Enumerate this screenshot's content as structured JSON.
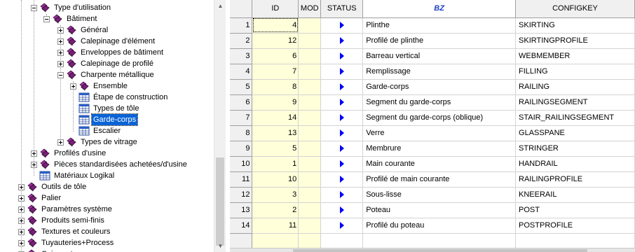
{
  "tree": {
    "nodes": [
      {
        "label": "Type d'utilisation",
        "icon": "books-icon",
        "expander": "minus"
      },
      {
        "label": "Bâtiment",
        "icon": "books-icon",
        "expander": "minus"
      },
      {
        "label": "Général",
        "icon": "books-icon",
        "expander": "plus"
      },
      {
        "label": "Calepinage d'élément",
        "icon": "books-icon",
        "expander": "plus"
      },
      {
        "label": "Enveloppes de bâtiment",
        "icon": "books-icon",
        "expander": "plus"
      },
      {
        "label": "Calepinage de profilé",
        "icon": "books-icon",
        "expander": "plus"
      },
      {
        "label": "Charpente métallique",
        "icon": "books-icon",
        "expander": "minus"
      },
      {
        "label": "Ensemble",
        "icon": "books-icon",
        "expander": "plus"
      },
      {
        "label": "Étape de construction",
        "icon": "table-icon",
        "expander": "none"
      },
      {
        "label": "Types de tôle",
        "icon": "table-icon",
        "expander": "none"
      },
      {
        "label": "Garde-corps",
        "icon": "table-icon",
        "expander": "none"
      },
      {
        "label": "Escalier",
        "icon": "table-icon",
        "expander": "none"
      },
      {
        "label": "Types de vitrage",
        "icon": "books-icon",
        "expander": "plus"
      },
      {
        "label": "Profilés d'usine",
        "icon": "books-icon",
        "expander": "plus"
      },
      {
        "label": "Pièces standardisées achetées/d'usine",
        "icon": "books-icon",
        "expander": "plus"
      },
      {
        "label": "Matériaux Logikal",
        "icon": "table-icon",
        "expander": "none"
      },
      {
        "label": "Outils de tôle",
        "icon": "books-icon",
        "expander": "plus"
      },
      {
        "label": "Palier",
        "icon": "books-icon",
        "expander": "plus"
      },
      {
        "label": "Paramètres système",
        "icon": "books-icon",
        "expander": "plus"
      },
      {
        "label": "Produits semi-finis",
        "icon": "books-icon",
        "expander": "plus"
      },
      {
        "label": "Textures et couleurs",
        "icon": "books-icon",
        "expander": "plus"
      },
      {
        "label": "Tuyauteries+Process",
        "icon": "books-icon",
        "expander": "plus"
      },
      {
        "label": "Coin porte verre",
        "icon": "books-icon",
        "expander": "plus"
      }
    ],
    "selected": "Garde-corps"
  },
  "grid": {
    "columns": [
      "",
      "ID",
      "MOD",
      "STATUS",
      "BZ",
      "CONFIGKEY"
    ],
    "rows": [
      {
        "n": "1",
        "id": "4",
        "mod": "",
        "bz": "Plinthe",
        "key": "SKIRTING"
      },
      {
        "n": "2",
        "id": "12",
        "mod": "",
        "bz": "Profilé de plinthe",
        "key": "SKIRTINGPROFILE"
      },
      {
        "n": "3",
        "id": "6",
        "mod": "",
        "bz": "Barreau vertical",
        "key": "WEBMEMBER"
      },
      {
        "n": "4",
        "id": "7",
        "mod": "",
        "bz": "Remplissage",
        "key": "FILLING"
      },
      {
        "n": "5",
        "id": "8",
        "mod": "",
        "bz": "Garde-corps",
        "key": "RAILING"
      },
      {
        "n": "6",
        "id": "9",
        "mod": "",
        "bz": "Segment du garde-corps",
        "key": "RAILINGSEGMENT"
      },
      {
        "n": "7",
        "id": "14",
        "mod": "",
        "bz": "Segment du garde-corps (oblique)",
        "key": "STAIR_RAILINGSEGMENT"
      },
      {
        "n": "8",
        "id": "13",
        "mod": "",
        "bz": "Verre",
        "key": "GLASSPANE"
      },
      {
        "n": "9",
        "id": "5",
        "mod": "",
        "bz": "Membrure",
        "key": "STRINGER"
      },
      {
        "n": "10",
        "id": "1",
        "mod": "",
        "bz": "Main courante",
        "key": "HANDRAIL"
      },
      {
        "n": "11",
        "id": "10",
        "mod": "",
        "bz": "Profilé de main courante",
        "key": "RAILINGPROFILE"
      },
      {
        "n": "12",
        "id": "3",
        "mod": "",
        "bz": "Sous-lisse",
        "key": "KNEERAIL"
      },
      {
        "n": "13",
        "id": "2",
        "mod": "",
        "bz": "Poteau",
        "key": "POST"
      },
      {
        "n": "14",
        "id": "11",
        "mod": "",
        "bz": "Profilé du poteau",
        "key": "POSTPROFILE"
      }
    ]
  }
}
